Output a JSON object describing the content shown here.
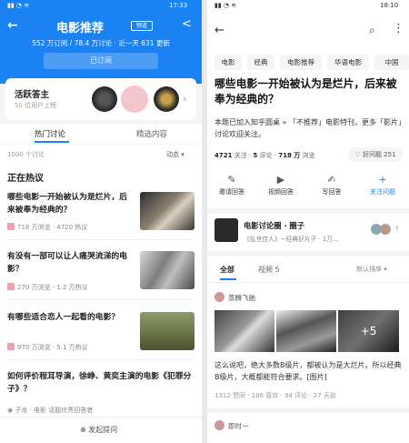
{
  "left": {
    "status_time": "17:33",
    "header": {
      "back": "←",
      "title": "电影推荐",
      "badge": "频道",
      "share": "⟨",
      "stats": "552 万订阅 / 78.4 万讨论 · 近一天 631 更新",
      "subscribed": "已订阅"
    },
    "active": {
      "title": "活跃答主",
      "count": "50",
      "suffix": "位用户上榜",
      "chev": "›"
    },
    "tabs": [
      "热门讨论",
      "精选内容"
    ],
    "discussion_count": "1000 个讨论",
    "sort": "动态 ▾",
    "section": "正在热议",
    "questions": [
      {
        "title": "哪些电影一开始被认为是烂片，后来被奉为经典的？",
        "meta": "718 万浏览 · 4720 热议"
      },
      {
        "title": "有没有一部可以让人痛哭流涕的电影？",
        "meta": "270 万浏览 · 1.2 万热议"
      },
      {
        "title": "有哪些适合恋人一起看的电影？",
        "meta": "970 万浏览 · 5.1 万热议"
      }
    ],
    "q4": {
      "title": "如何评价程耳导演，徐峥、黄奕主演的电影《犯罪分子》？",
      "user": "子龙",
      "note": "电影 话题优秀回答者"
    },
    "ask": "⊕ 发起提问"
  },
  "right": {
    "status_time": "18:10",
    "back": "←",
    "search": "⌕",
    "more": "⋮",
    "chips": [
      "电影",
      "经典",
      "电影推荐",
      "华语电影",
      "中国"
    ],
    "title": "哪些电影一开始被认为是烂片，后来被奉为经典的？",
    "desc": "本题已加入知乎圆桌 » 「不推荐」电影特刊，更多「影片」讨论欢迎关注。",
    "stats": {
      "follow": "4721",
      "follow_l": "关注",
      "comments": "5",
      "comments_l": "评论",
      "views": "718 万",
      "views_l": "浏览"
    },
    "good": "♡ 好问题 251",
    "actions": [
      {
        "icon": "✎",
        "label": "邀请回答"
      },
      {
        "icon": "▶",
        "label": "视频回答"
      },
      {
        "icon": "✍",
        "label": "写回答"
      },
      {
        "icon": "+",
        "label": "关注问题"
      }
    ],
    "circle": {
      "name": "电影讨论圈 · 圈子",
      "sub": "《乱世佳人》~经典好片子 · 1万..."
    },
    "tabs": {
      "all": "全部",
      "video": "视频 5",
      "sort": "默认排序 ▾"
    },
    "answer": {
      "user": "蒸腾飞驰",
      "plus": "+5",
      "text": "这么说吧，绝大多数B级片，都被认为是大烂片。所以经典B级片，大概都能符合要求。[图片]",
      "meta": "1312 赞同 · 186 喜欢 · 94 评论 · 27 天前"
    },
    "next_user": "即时一"
  }
}
